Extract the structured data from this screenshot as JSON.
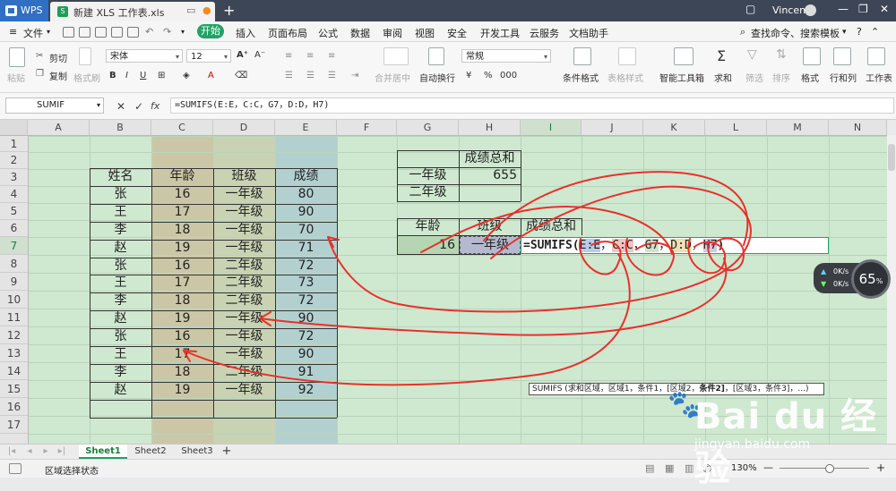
{
  "titlebar": {
    "app": "WPS",
    "doc_tab": "新建 XLS 工作表.xls",
    "new_tab": "+",
    "user": "Vincent"
  },
  "menu": {
    "file": "文件",
    "start": "开始",
    "items": [
      "插入",
      "页面布局",
      "公式",
      "数据",
      "审阅",
      "视图",
      "安全",
      "开发工具",
      "云服务",
      "文档助手"
    ],
    "search": "查找命令、搜索模板"
  },
  "ribbon": {
    "paste": "粘贴",
    "cut": "剪切",
    "copy": "复制",
    "format_painter": "格式刷",
    "font": "宋体",
    "font_size": "12",
    "merge_center": "合并居中",
    "auto_wrap": "自动换行",
    "number_format": "常规",
    "cond_format": "条件格式",
    "table_style": "表格样式",
    "smart_toolbox": "智能工具箱",
    "sum": "求和",
    "filter": "筛选",
    "sort": "排序",
    "format": "格式",
    "row_col": "行和列",
    "worksheet": "工作表"
  },
  "formulabar": {
    "name_box": "SUMIF",
    "fx": "fx",
    "formula": "=SUMIFS(E:E，C:C，G7，D:D，H7)"
  },
  "columns": [
    "A",
    "B",
    "C",
    "D",
    "E",
    "F",
    "G",
    "H",
    "I",
    "J",
    "K",
    "L",
    "M",
    "N"
  ],
  "rows": [
    "1",
    "2",
    "3",
    "4",
    "5",
    "6",
    "7",
    "8",
    "9",
    "10",
    "11",
    "12",
    "13",
    "14",
    "15",
    "16",
    "17"
  ],
  "table": {
    "headers": [
      "姓名",
      "年龄",
      "班级",
      "成绩"
    ],
    "rows": [
      [
        "张",
        "16",
        "一年级",
        "80"
      ],
      [
        "王",
        "17",
        "一年级",
        "90"
      ],
      [
        "李",
        "18",
        "一年级",
        "70"
      ],
      [
        "赵",
        "19",
        "一年级",
        "71"
      ],
      [
        "张",
        "16",
        "二年级",
        "72"
      ],
      [
        "王",
        "17",
        "二年级",
        "73"
      ],
      [
        "李",
        "18",
        "二年级",
        "72"
      ],
      [
        "赵",
        "19",
        "一年级",
        "90"
      ],
      [
        "张",
        "16",
        "一年级",
        "72"
      ],
      [
        "王",
        "17",
        "一年级",
        "90"
      ],
      [
        "李",
        "18",
        "二年级",
        "91"
      ],
      [
        "赵",
        "19",
        "一年级",
        "92"
      ]
    ]
  },
  "summary1": {
    "header": "成绩总和",
    "row1_label": "一年级",
    "row1_value": "655",
    "row2_label": "二年级"
  },
  "summary2": {
    "h1": "年龄",
    "h2": "班级",
    "h3": "成绩总和",
    "age": "16",
    "grade": "一年级",
    "formula_prefix": "=SUMIFS(",
    "formula_args": [
      "E:E",
      "C:C",
      "G7",
      "D:D",
      "H7"
    ],
    "formula_end": ")"
  },
  "tooltip": "SUMIFS (求和区域，区域1，条件1，[区域2，条件2]，[区域3，条件3]，...)",
  "tooltip_parts": {
    "a": "SUMIFS (求和区域，区域1，条件1，[区域2，",
    "b": "条件2]",
    "c": "，[区域3，条件3]，...)"
  },
  "sheets": [
    "Sheet1",
    "Sheet2",
    "Sheet3"
  ],
  "status": "区域选择状态",
  "zoom": "130%",
  "net": {
    "up": "0K/s",
    "down": "0K/s",
    "percent": "65",
    "unit": "%"
  },
  "watermark": {
    "brand": "Bai du 经验",
    "url": "jingyan.baidu.com"
  },
  "colors": {
    "accent": "#21a366",
    "grid_bg": "#cfe8d0",
    "annotation": "#e8312a"
  }
}
